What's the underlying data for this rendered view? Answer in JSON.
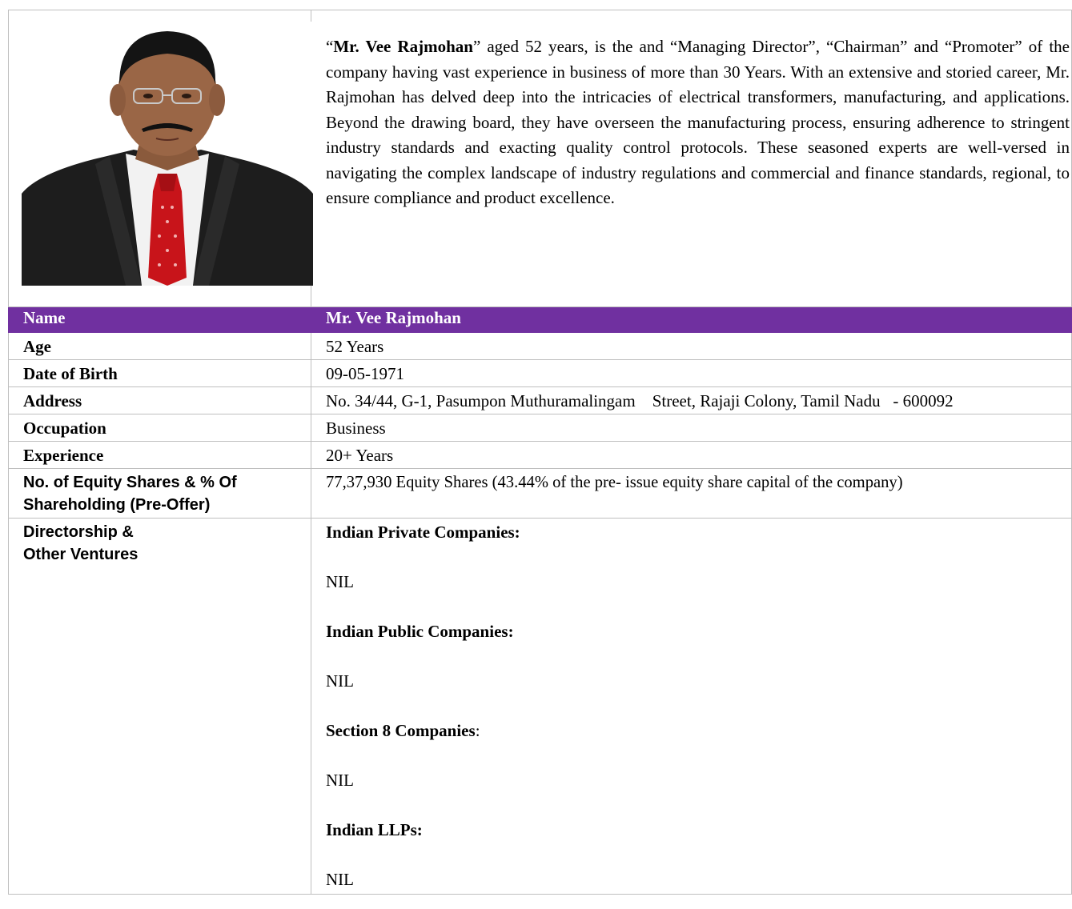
{
  "profile": {
    "bio_name": "Mr. Vee Rajmohan",
    "bio_open_quote": "“",
    "bio_text": "” aged 52 years, is the and “Managing Director”, “Chairman” and “Promoter” of the company having vast experience in business of more than 30 Years. With an extensive and storied career, Mr. Rajmohan has delved deep into the intricacies of electrical transformers, manufacturing, and applications. Beyond the drawing board, they have overseen the manufacturing process, ensuring adherence to stringent industry standards and exacting quality control protocols. These seasoned experts are well-versed in navigating the complex landscape of industry regulations and commercial and finance standards, regional, to ensure compliance and product excellence."
  },
  "table": {
    "header": {
      "label": "Name",
      "value": "Mr. Vee Rajmohan"
    },
    "rows": [
      {
        "label": "Age",
        "value": "52 Years"
      },
      {
        "label": "Date of Birth",
        "value": "09-05-1971"
      },
      {
        "label": "Address",
        "value": "No. 34/44, G-1, Pasumpon Muthuramalingam    Street, Rajaji Colony, Tamil Nadu   - 600092"
      },
      {
        "label": "Occupation",
        "value": "Business"
      },
      {
        "label": "Experience",
        "value": "20+ Years"
      },
      {
        "label": "No. of Equity Shares & % Of Shareholding (Pre-Offer)",
        "value": "77,37,930 Equity Shares (43.44% of the pre- issue equity share capital of the company)"
      }
    ],
    "directorship": {
      "label": "Directorship & Other Ventures",
      "sections": [
        {
          "title": "Indian Private Companies:",
          "value": "NIL"
        },
        {
          "title": "Indian Public Companies:",
          "value": "NIL"
        },
        {
          "title": "Section 8 Companies",
          "suffix": ":",
          "value": "NIL"
        },
        {
          "title": "Indian LLPs:",
          "value": "NIL"
        }
      ]
    }
  },
  "colors": {
    "header_bg": "#7030a0",
    "header_text": "#ffffff",
    "border": "#bfbfbf"
  },
  "icons": {
    "portrait": "person-portrait-photo"
  }
}
